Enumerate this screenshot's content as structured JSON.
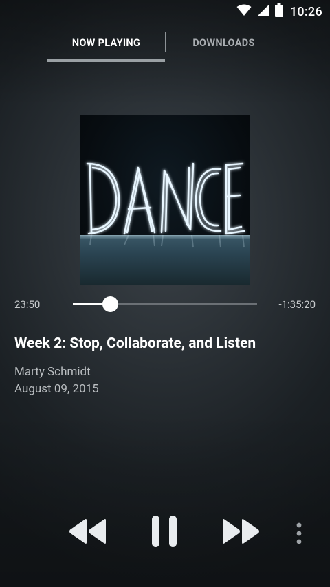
{
  "status_bar": {
    "time": "10:26",
    "icons": [
      "wifi-icon",
      "cell-signal-icon",
      "battery-icon"
    ]
  },
  "tabs": [
    {
      "label": "NOW PLAYING",
      "active": true
    },
    {
      "label": "DOWNLOADS",
      "active": false
    }
  ],
  "album_art": {
    "text": "DANCE"
  },
  "player": {
    "elapsed": "23:50",
    "remaining": "-1:35:20",
    "progress_percent": 20
  },
  "episode": {
    "title": "Week 2: Stop, Collaborate, and Listen",
    "speaker": "Marty Schmidt",
    "date": "August 09, 2015"
  },
  "controls": {
    "icons": [
      "rewind-icon",
      "pause-icon",
      "fast-forward-icon",
      "more-vert-icon"
    ]
  },
  "colors": {
    "accent": "#ffffff",
    "track": "#6b7075",
    "secondary_text": "#b9bdc0"
  }
}
